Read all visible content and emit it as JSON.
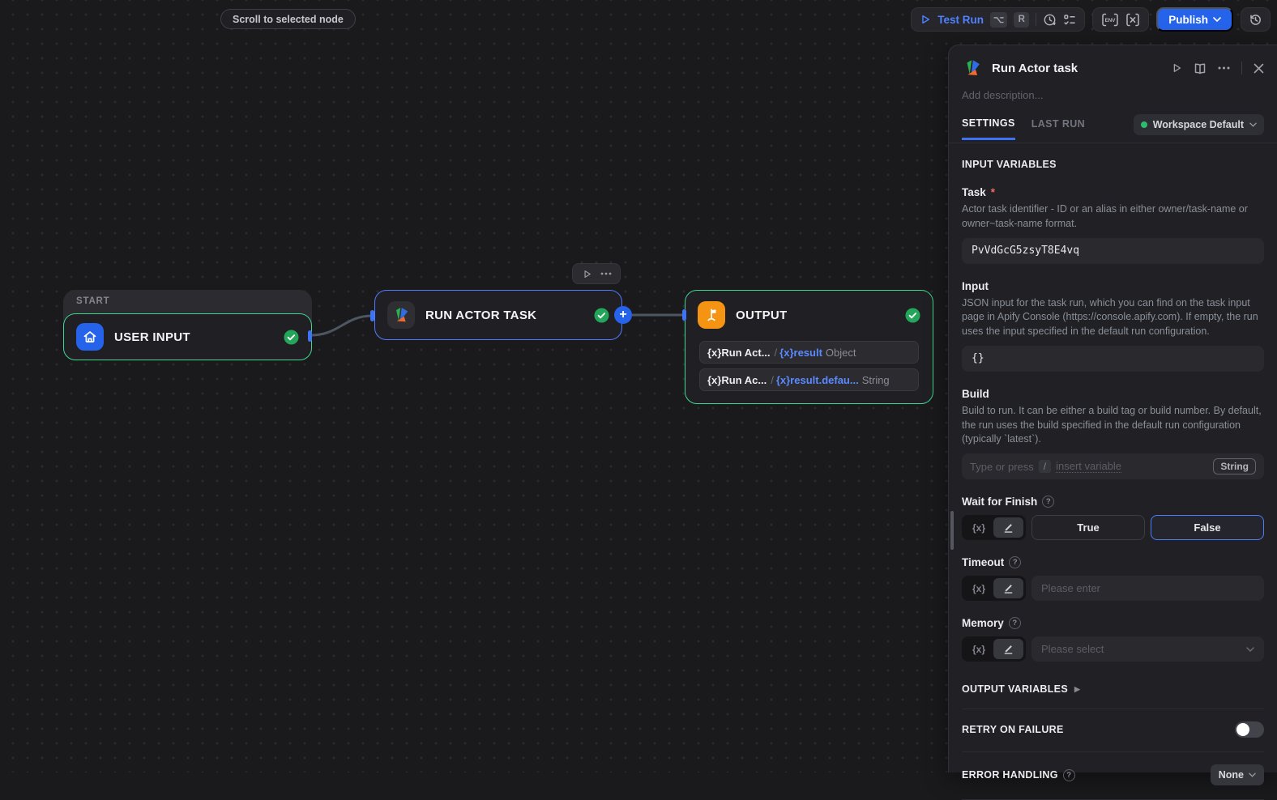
{
  "canvas": {
    "scroll_to_node_label": "Scroll to selected node",
    "start_group_label": "START",
    "nodes": [
      {
        "title": "USER INPUT"
      },
      {
        "title": "RUN ACTOR TASK"
      },
      {
        "title": "OUTPUT"
      }
    ],
    "output_variables": [
      {
        "source": "{x}Run Act...",
        "sep": "/",
        "path": "{x}result",
        "type": "Object"
      },
      {
        "source": "{x}Run Ac...",
        "sep": "/",
        "path": "{x}result.defau...",
        "type": "String"
      }
    ]
  },
  "topbar": {
    "test_run": {
      "label": "Test Run",
      "keys": [
        "⌥",
        "R"
      ]
    },
    "publish": {
      "label": "Publish"
    }
  },
  "panel": {
    "title": "Run Actor task",
    "description_placeholder": "Add description...",
    "tabs": [
      {
        "label": "SETTINGS"
      },
      {
        "label": "LAST RUN"
      }
    ],
    "workspace_selector": {
      "label": "Workspace Default"
    },
    "input_variables": {
      "heading": "INPUT VARIABLES",
      "task": {
        "label": "Task",
        "required_mark": "*",
        "description": "Actor task identifier - ID or an alias in either owner/task-name or owner~task-name format.",
        "value": "PvVdGcG5zsyT8E4vq"
      },
      "input": {
        "label": "Input",
        "description": "JSON input for the task run, which you can find on the task input page in Apify Console (https://console.apify.com). If empty, the run uses the input specified in the default run configuration.",
        "value": "{}"
      },
      "build": {
        "label": "Build",
        "description": "Build to run. It can be either a build tag or build number. By default, the run uses the build specified in the default run configuration (typically `latest`).",
        "placeholder_prefix": "Type or press",
        "placeholder_key": "/",
        "placeholder_suffix": "insert variable",
        "type_badge": "String"
      },
      "wait_for_finish": {
        "label": "Wait for Finish",
        "var_button": "{x}",
        "true_label": "True",
        "false_label": "False"
      },
      "timeout": {
        "label": "Timeout",
        "var_button": "{x}",
        "placeholder": "Please enter"
      },
      "memory": {
        "label": "Memory",
        "var_button": "{x}",
        "placeholder": "Please select"
      }
    },
    "output_variables_heading": "OUTPUT VARIABLES",
    "retry_on_failure": {
      "heading": "RETRY ON FAILURE",
      "enabled": false
    },
    "error_handling": {
      "heading": "ERROR HANDLING",
      "value": "None"
    }
  }
}
